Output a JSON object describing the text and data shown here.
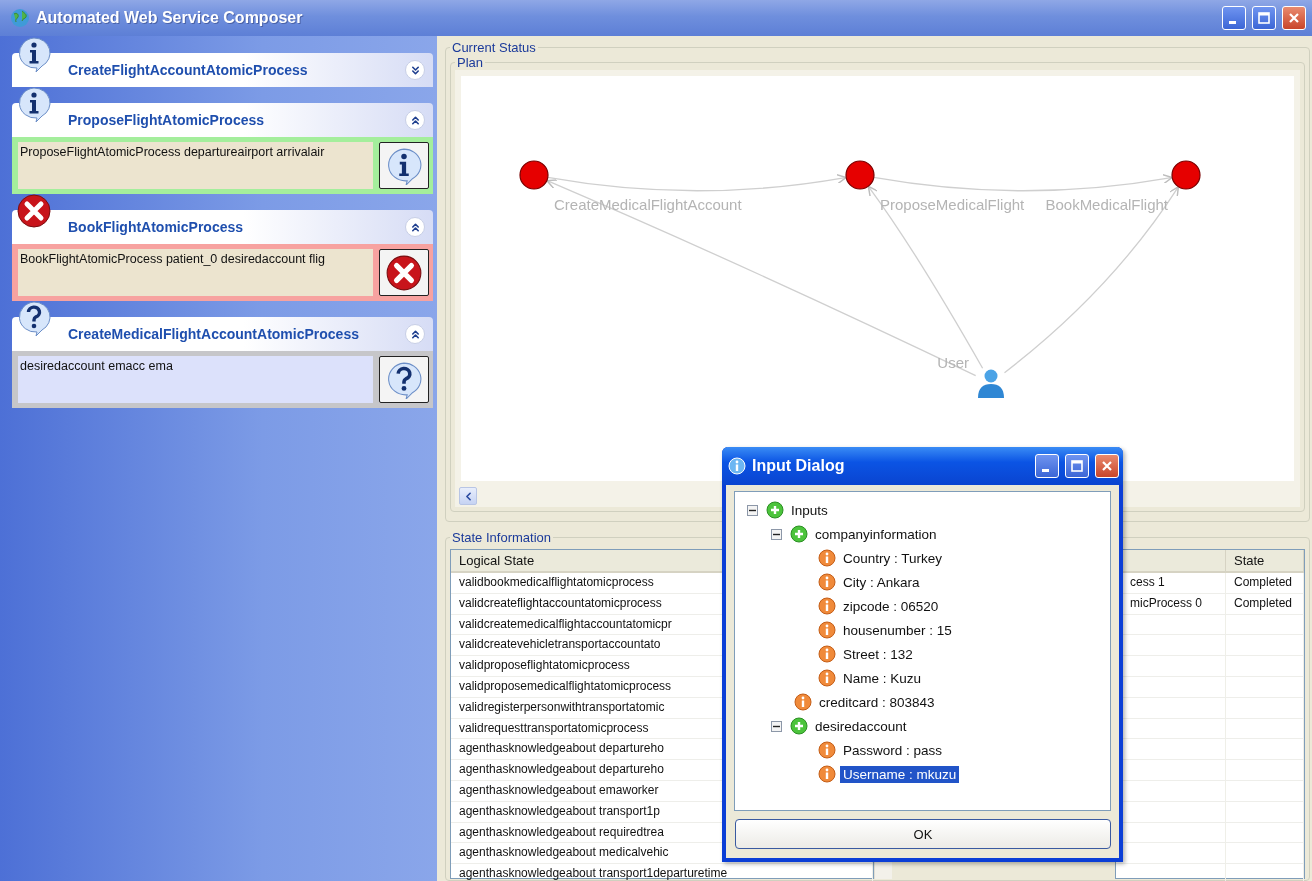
{
  "window": {
    "title": "Automated Web Service Composer"
  },
  "processes": [
    {
      "title": "CreateFlightAccountAtomicProcess",
      "kind": "info",
      "expanded": false
    },
    {
      "title": "ProposeFlightAtomicProcess",
      "kind": "info",
      "expanded": true,
      "detail": "ProposeFlightAtomicProcess departureairport arrivalair"
    },
    {
      "title": "BookFlightAtomicProcess",
      "kind": "error",
      "expanded": true,
      "detail": "BookFlightAtomicProcess patient_0 desiredaccount flig"
    },
    {
      "title": "CreateMedicalFlightAccountAtomicProcess",
      "kind": "question",
      "expanded": true,
      "detail": "desiredaccount emacc ema"
    }
  ],
  "current_status": {
    "title": "Current Status",
    "plan": {
      "title": "Plan",
      "nodes": [
        {
          "kind": "service",
          "label": "CreateMedicalFlightAccount"
        },
        {
          "kind": "service",
          "label": "ProposeMedicalFlight"
        },
        {
          "kind": "service",
          "label": "BookMedicalFlight"
        },
        {
          "kind": "user",
          "label": "User"
        }
      ]
    }
  },
  "state_information": {
    "title": "State Information",
    "logical_states": {
      "header": "Logical State",
      "rows": [
        "validbookmedicalflightatomicprocess",
        "validcreateflightaccountatomicprocess",
        "validcreatemedicalflightaccountatomicpr",
        "validcreatevehicletransportaccountato",
        "validproposeflightatomicprocess",
        "validproposemedicalflightatomicprocess",
        "validregisterpersonwithtransportatomic",
        "validrequesttransportatomicprocess",
        "agenthasknowledgeabout departureho",
        "agenthasknowledgeabout departureho",
        "agenthasknowledgeabout emaworker",
        "agenthasknowledgeabout transport1p",
        "agenthasknowledgeabout requiredtrea",
        "agenthasknowledgeabout medicalvehic",
        "agenthasknowledgeabout transport1departuretime"
      ]
    },
    "executions": {
      "state_header": "State",
      "rows": [
        {
          "column_1": "cess 1",
          "state": "Completed"
        },
        {
          "column_1": "micProcess 0",
          "state": "Completed"
        }
      ]
    }
  },
  "input_dialog": {
    "title": "Input Dialog",
    "button": "OK",
    "tree": [
      {
        "label": "Inputs",
        "kind": "group",
        "expanded": true,
        "selected": false,
        "children": [
          {
            "label": "companyinformation",
            "kind": "group",
            "expanded": true,
            "selected": false,
            "children": [
              {
                "label": "Country : Turkey",
                "kind": "value",
                "selected": false
              },
              {
                "label": "City : Ankara",
                "kind": "value",
                "selected": false
              },
              {
                "label": "zipcode : 06520",
                "kind": "value",
                "selected": false
              },
              {
                "label": "housenumber : 15",
                "kind": "value",
                "selected": false
              },
              {
                "label": "Street : 132",
                "kind": "value",
                "selected": false
              },
              {
                "label": "Name : Kuzu",
                "kind": "value",
                "selected": false
              }
            ]
          },
          {
            "label": "creditcard : 803843",
            "kind": "value",
            "selected": false
          },
          {
            "label": "desiredaccount",
            "kind": "group",
            "expanded": true,
            "selected": false,
            "children": [
              {
                "label": "Password : pass",
                "kind": "value",
                "selected": false
              },
              {
                "label": "Username : mkuzu",
                "kind": "value",
                "selected": true
              }
            ]
          }
        ]
      }
    ]
  }
}
